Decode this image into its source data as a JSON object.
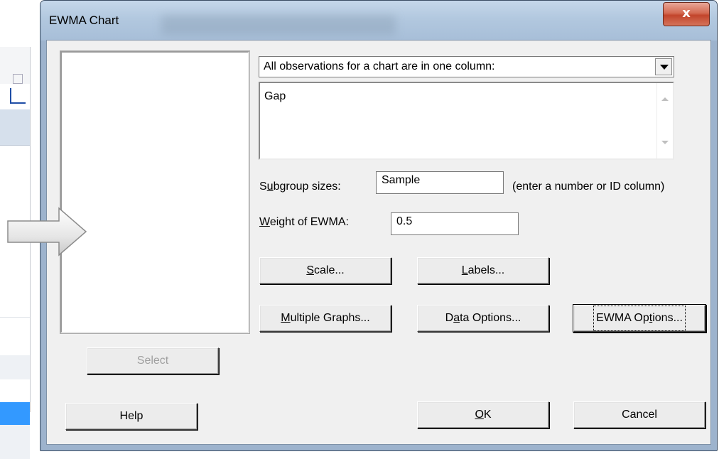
{
  "window": {
    "title": "EWMA Chart",
    "background_title": "Xbar-R Chart of weight",
    "close_symbol": "x"
  },
  "chart_type_select": {
    "selected": "All observations for a chart are in one column:"
  },
  "variables": {
    "value": "Gap"
  },
  "subgroup": {
    "label_pre": "S",
    "label_mnemonic": "u",
    "label_post": "bgroup sizes:",
    "value": "Sample",
    "hint": "(enter a number or ID column)"
  },
  "weight": {
    "label_mnemonic": "W",
    "label_post": "eight of EWMA:",
    "value": "0.5"
  },
  "buttons": {
    "scale": {
      "mnemonic": "S",
      "rest": "cale..."
    },
    "labels": {
      "mnemonic": "L",
      "rest": "abels..."
    },
    "multiple_graphs": {
      "mnemonic": "M",
      "rest": "ultiple Graphs..."
    },
    "data_options": {
      "pre": "D",
      "mnemonic": "a",
      "rest": "ta Options..."
    },
    "ewma_options": {
      "pre": "EWMA Op",
      "mnemonic": "t",
      "rest": "ions..."
    },
    "select": "Select",
    "help": "Help",
    "ok": {
      "mnemonic": "O",
      "rest": "K"
    },
    "cancel": "Cancel"
  },
  "colors": {
    "selected_row": "#3399ff",
    "close_button": "#c2452c",
    "frame": "#9db3cd"
  }
}
